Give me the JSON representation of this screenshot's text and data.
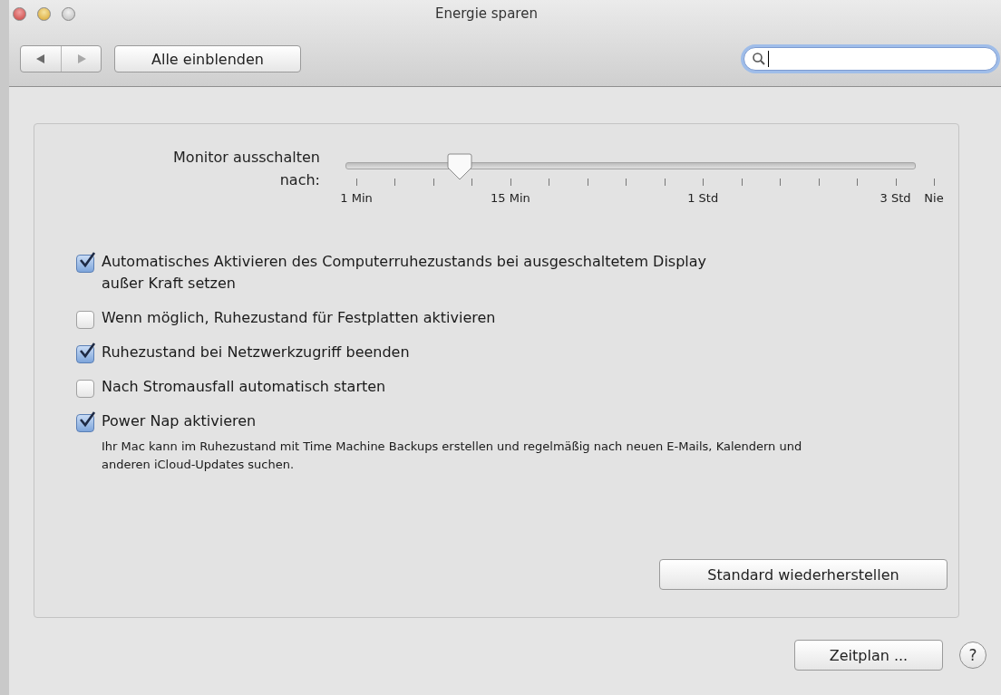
{
  "window": {
    "title": "Energie sparen"
  },
  "toolbar": {
    "show_all_button": "Alle einblenden",
    "search": {
      "kind": "focused"
    }
  },
  "slider": {
    "label": "Monitor ausschalten nach:",
    "level": 0.2,
    "ticks": [
      {
        "kind": "labeled",
        "label": "1 Min"
      },
      {
        "kind": "tick"
      },
      {
        "kind": "tick"
      },
      {
        "kind": "tick"
      },
      {
        "kind": "labeled",
        "label": "15 Min"
      },
      {
        "kind": "tick"
      },
      {
        "kind": "tick"
      },
      {
        "kind": "tick"
      },
      {
        "kind": "tick"
      },
      {
        "kind": "labeled",
        "label": "1 Std"
      },
      {
        "kind": "tick"
      },
      {
        "kind": "tick"
      },
      {
        "kind": "tick"
      },
      {
        "kind": "tick"
      },
      {
        "kind": "labeled",
        "label": "3 Std"
      },
      {
        "kind": "labeled",
        "label": "Nie"
      }
    ]
  },
  "options": [
    {
      "label": "Automatisches Aktivieren des Computerruhezustands bei ausgeschaltetem Display außer Kraft setzen",
      "checked": true
    },
    {
      "label": "Wenn möglich, Ruhezustand für Festplatten aktivieren",
      "checked": false
    },
    {
      "label": "Ruhezustand bei Netzwerkzugriff beenden",
      "checked": true
    },
    {
      "label": "Nach Stromausfall automatisch starten",
      "checked": false
    },
    {
      "label": "Power Nap aktivieren",
      "checked": true,
      "description": "Ihr Mac kann im Ruhezustand mit Time Machine Backups erstellen und regelmäßig nach neuen E-Mails, Kalendern und anderen iCloud-Updates suchen."
    }
  ],
  "restore_button": "Standard wiederherstellen",
  "schedule_button": "Zeitplan ...",
  "help_button": "?"
}
